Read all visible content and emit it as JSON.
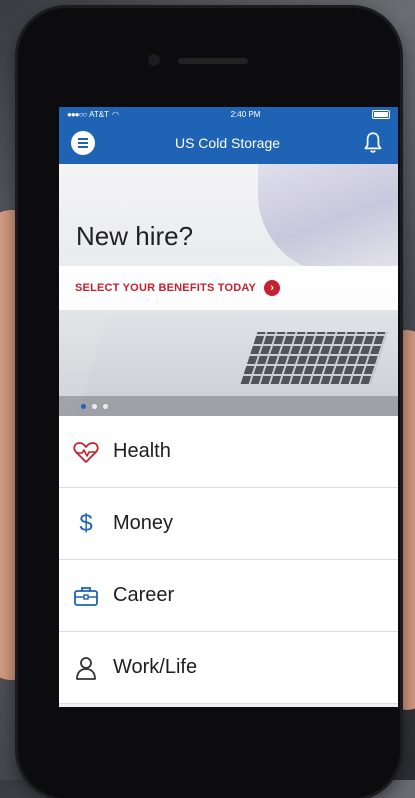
{
  "status_bar": {
    "carrier": "AT&T",
    "time": "2:40 PM"
  },
  "app_bar": {
    "title": "US Cold Storage",
    "menu_icon": "menu-icon",
    "notification_icon": "bell-icon"
  },
  "hero": {
    "title": "New hire?",
    "cta": "SELECT YOUR BENEFITS TODAY",
    "cta_icon": "chevron-right-icon",
    "carousel": {
      "pages": 3,
      "active_index": 0
    }
  },
  "menu": {
    "items": [
      {
        "label": "Health",
        "icon": "heart-pulse-icon",
        "color": "#c8202e"
      },
      {
        "label": "Money",
        "icon": "dollar-icon",
        "color": "#1f63b5"
      },
      {
        "label": "Career",
        "icon": "briefcase-icon",
        "color": "#1f63b5"
      },
      {
        "label": "Work/Life",
        "icon": "person-icon",
        "color": "#333333"
      }
    ]
  },
  "colors": {
    "brand_blue": "#1f63b5",
    "accent_red": "#c8202e"
  }
}
